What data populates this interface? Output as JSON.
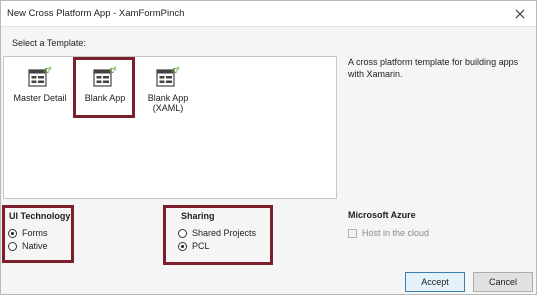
{
  "window": {
    "title": "New Cross Platform App - XamFormPinch"
  },
  "templates": {
    "heading": "Select a Template:",
    "items": [
      {
        "label_1": "Master Detail",
        "label_2": ""
      },
      {
        "label_1": "Blank App",
        "label_2": ""
      },
      {
        "label_1": "Blank App",
        "label_2": "(XAML)"
      }
    ],
    "selected": "Blank App",
    "description": "A cross platform template for building apps with Xamarin."
  },
  "ui_technology": {
    "title": "UI Technology",
    "options": [
      "Forms",
      "Native"
    ],
    "selected": "Forms"
  },
  "sharing": {
    "title": "Sharing",
    "options": [
      "Shared Projects",
      "PCL"
    ],
    "selected": "PCL"
  },
  "azure": {
    "title": "Microsoft Azure",
    "host_label": "Host in the cloud",
    "host_checked": false
  },
  "buttons": {
    "accept": "Accept",
    "cancel": "Cancel"
  },
  "colors": {
    "highlight": "#7b1f2a",
    "csharp_badge": "#5aa02c",
    "accept_border": "#3c7fb1"
  },
  "icons": {
    "close": "close-icon",
    "template": "cross-platform-template-icon"
  }
}
